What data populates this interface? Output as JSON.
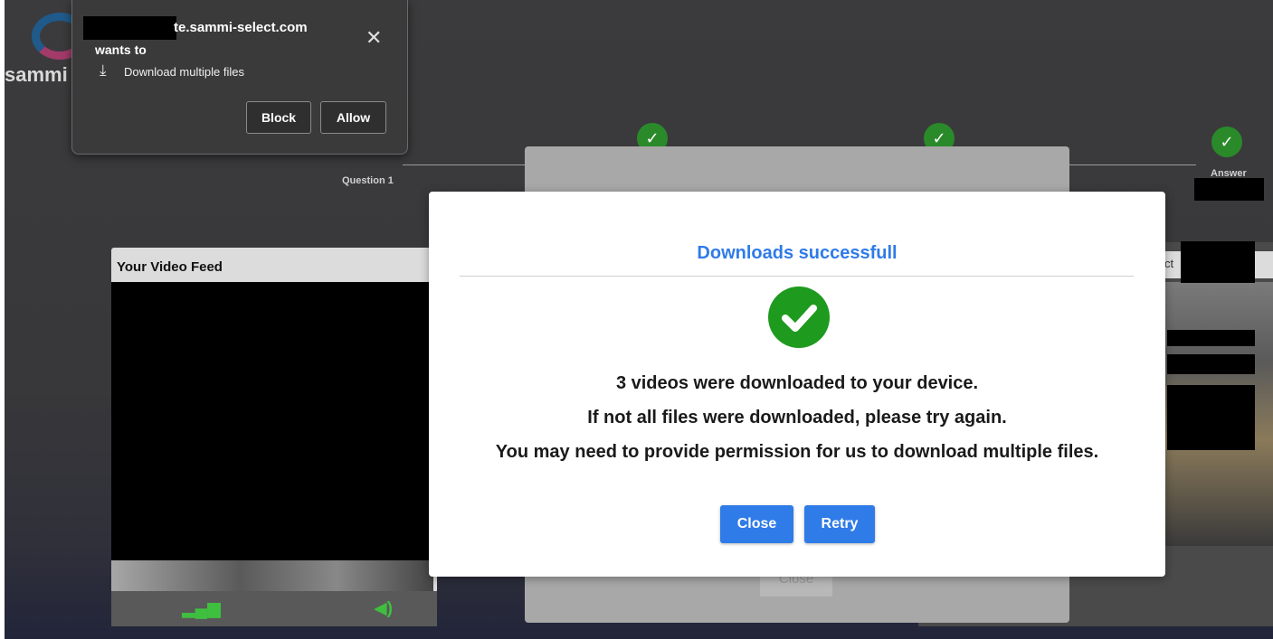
{
  "background": {
    "logo_text": "sammi s",
    "steps": [
      {
        "label": "Question 1"
      },
      {
        "label": ""
      },
      {
        "label": ""
      },
      {
        "label": "Answer"
      }
    ],
    "video_panel": {
      "title": "Your Video Feed"
    },
    "right_panel": {
      "label": "ct"
    },
    "gray_dialog": {
      "close_label": "Close"
    }
  },
  "permission_popup": {
    "site": "te.sammi-select.com",
    "wants": "wants to",
    "request": "Download multiple files",
    "block_label": "Block",
    "allow_label": "Allow",
    "close_glyph": "✕",
    "download_glyph": "⤓"
  },
  "modal": {
    "title": "Downloads successfull",
    "line1": "3 videos were downloaded to your device.",
    "line2": "If not all files were downloaded, please try again.",
    "line3": "You may need to provide permission for us to download multiple files.",
    "close_label": "Close",
    "retry_label": "Retry"
  },
  "colors": {
    "accent": "#2f7be8",
    "success": "#1e9a1e",
    "step_green": "#2a8a2a"
  }
}
